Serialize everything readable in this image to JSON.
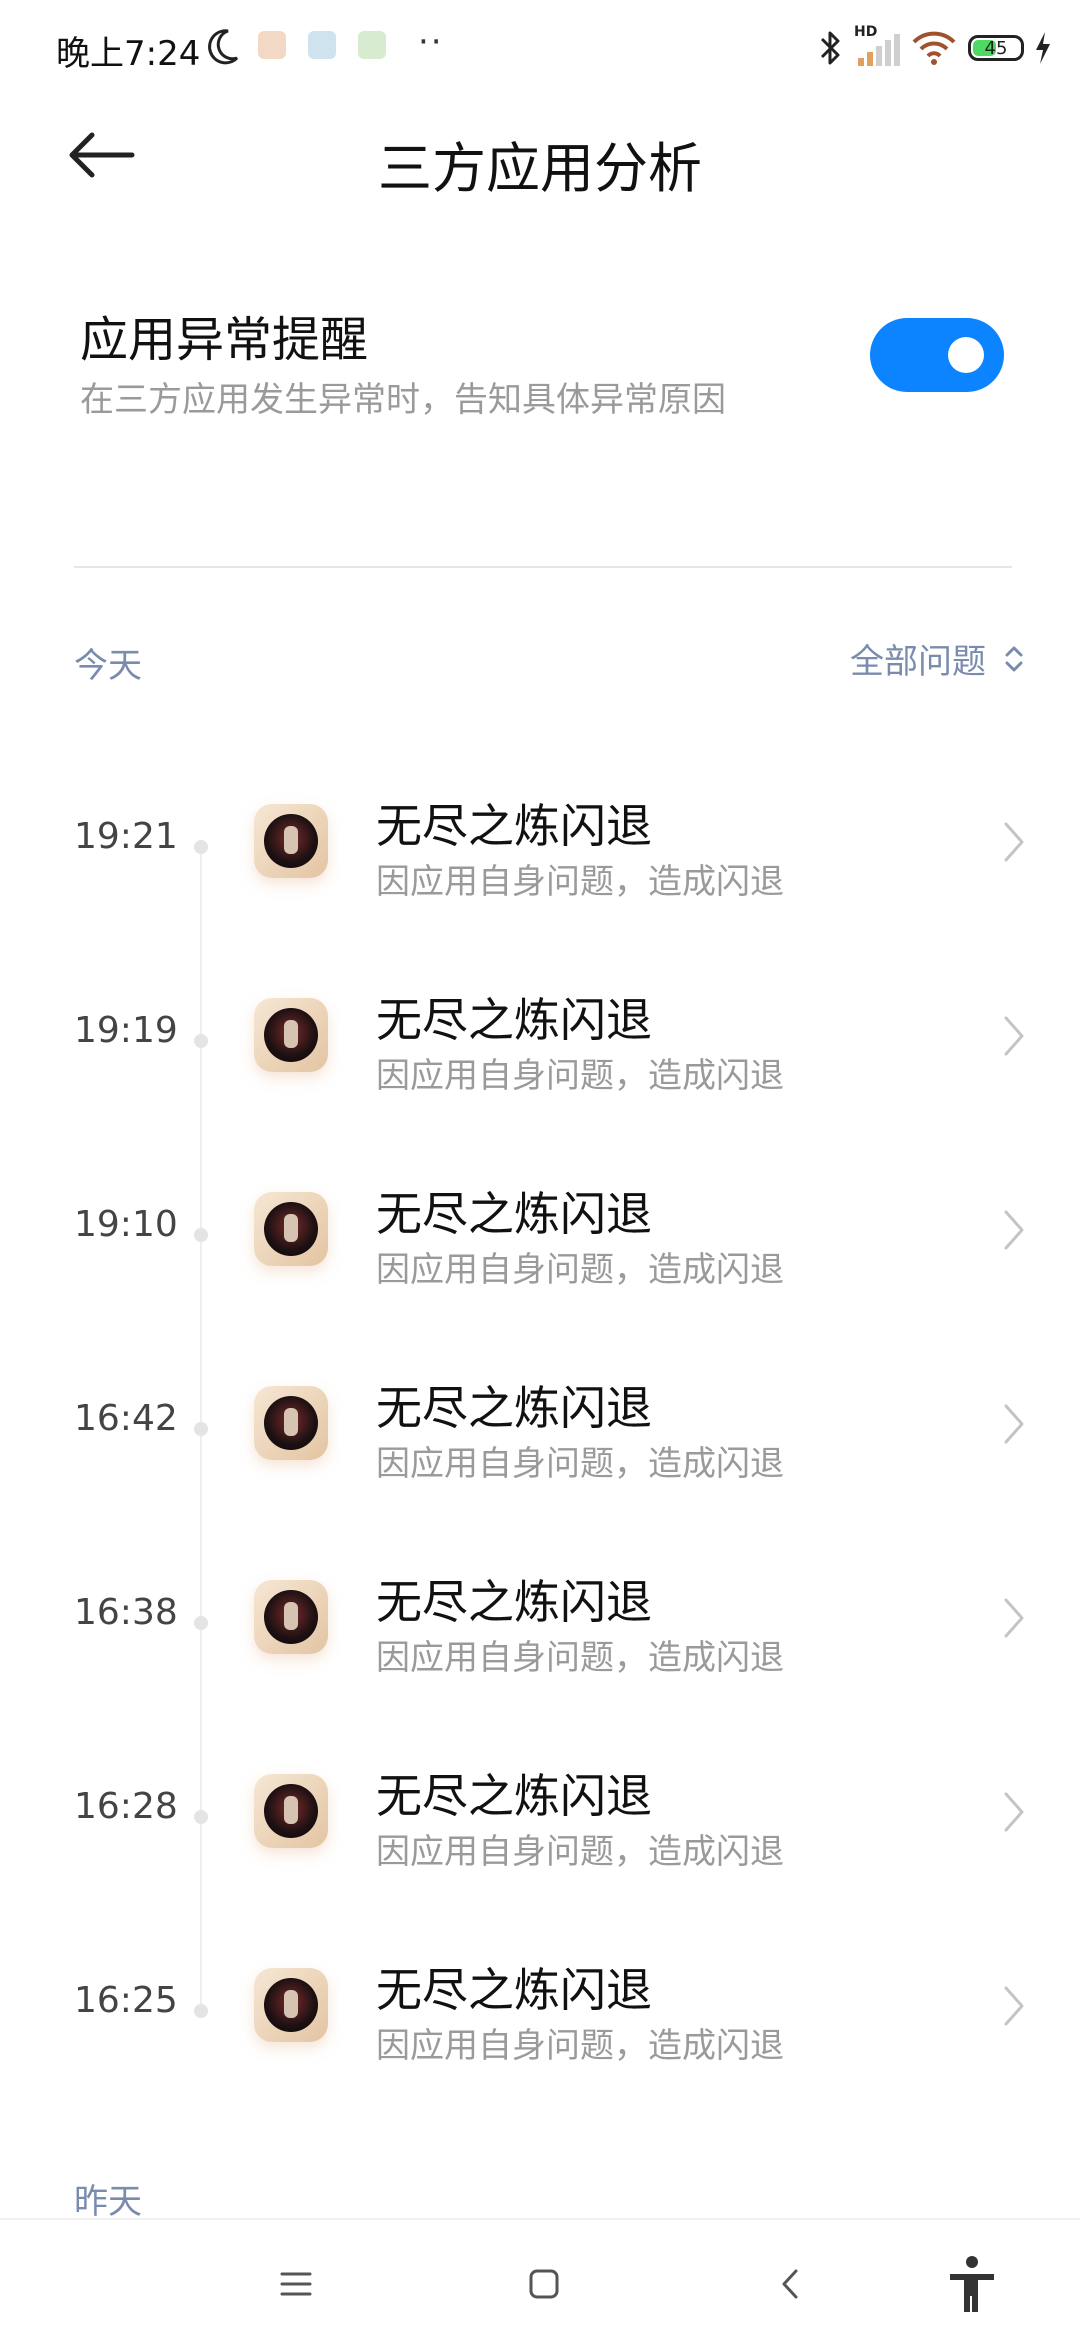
{
  "status_bar": {
    "time": "晚上7:24",
    "dots": "··",
    "hd_label": "HD",
    "battery_level": "45",
    "icons": [
      "moon-icon",
      "app-notify-icon",
      "app-notify-icon",
      "app-notify-icon",
      "bluetooth-icon",
      "signal-icon",
      "wifi-icon",
      "battery-icon",
      "charging-icon"
    ]
  },
  "header": {
    "title": "三方应用分析",
    "back_icon": "arrow-left-icon"
  },
  "setting": {
    "title": "应用异常提醒",
    "description": "在三方应用发生异常时，告知具体异常原因",
    "toggle_on": true,
    "accent_color": "#0d84ff"
  },
  "sections": {
    "today_label": "今天",
    "filter_label": "全部问题",
    "yesterday_label": "昨天"
  },
  "items": [
    {
      "time": "19:21",
      "title": "无尽之炼闪退",
      "subtitle": "因应用自身问题，造成闪退"
    },
    {
      "time": "19:19",
      "title": "无尽之炼闪退",
      "subtitle": "因应用自身问题，造成闪退"
    },
    {
      "time": "19:10",
      "title": "无尽之炼闪退",
      "subtitle": "因应用自身问题，造成闪退"
    },
    {
      "time": "16:42",
      "title": "无尽之炼闪退",
      "subtitle": "因应用自身问题，造成闪退"
    },
    {
      "time": "16:38",
      "title": "无尽之炼闪退",
      "subtitle": "因应用自身问题，造成闪退"
    },
    {
      "time": "16:28",
      "title": "无尽之炼闪退",
      "subtitle": "因应用自身问题，造成闪退"
    },
    {
      "time": "16:25",
      "title": "无尽之炼闪退",
      "subtitle": "因应用自身问题，造成闪退"
    }
  ],
  "navbar": {
    "icons": [
      "menu-icon",
      "home-icon",
      "back-icon",
      "accessibility-icon"
    ]
  }
}
